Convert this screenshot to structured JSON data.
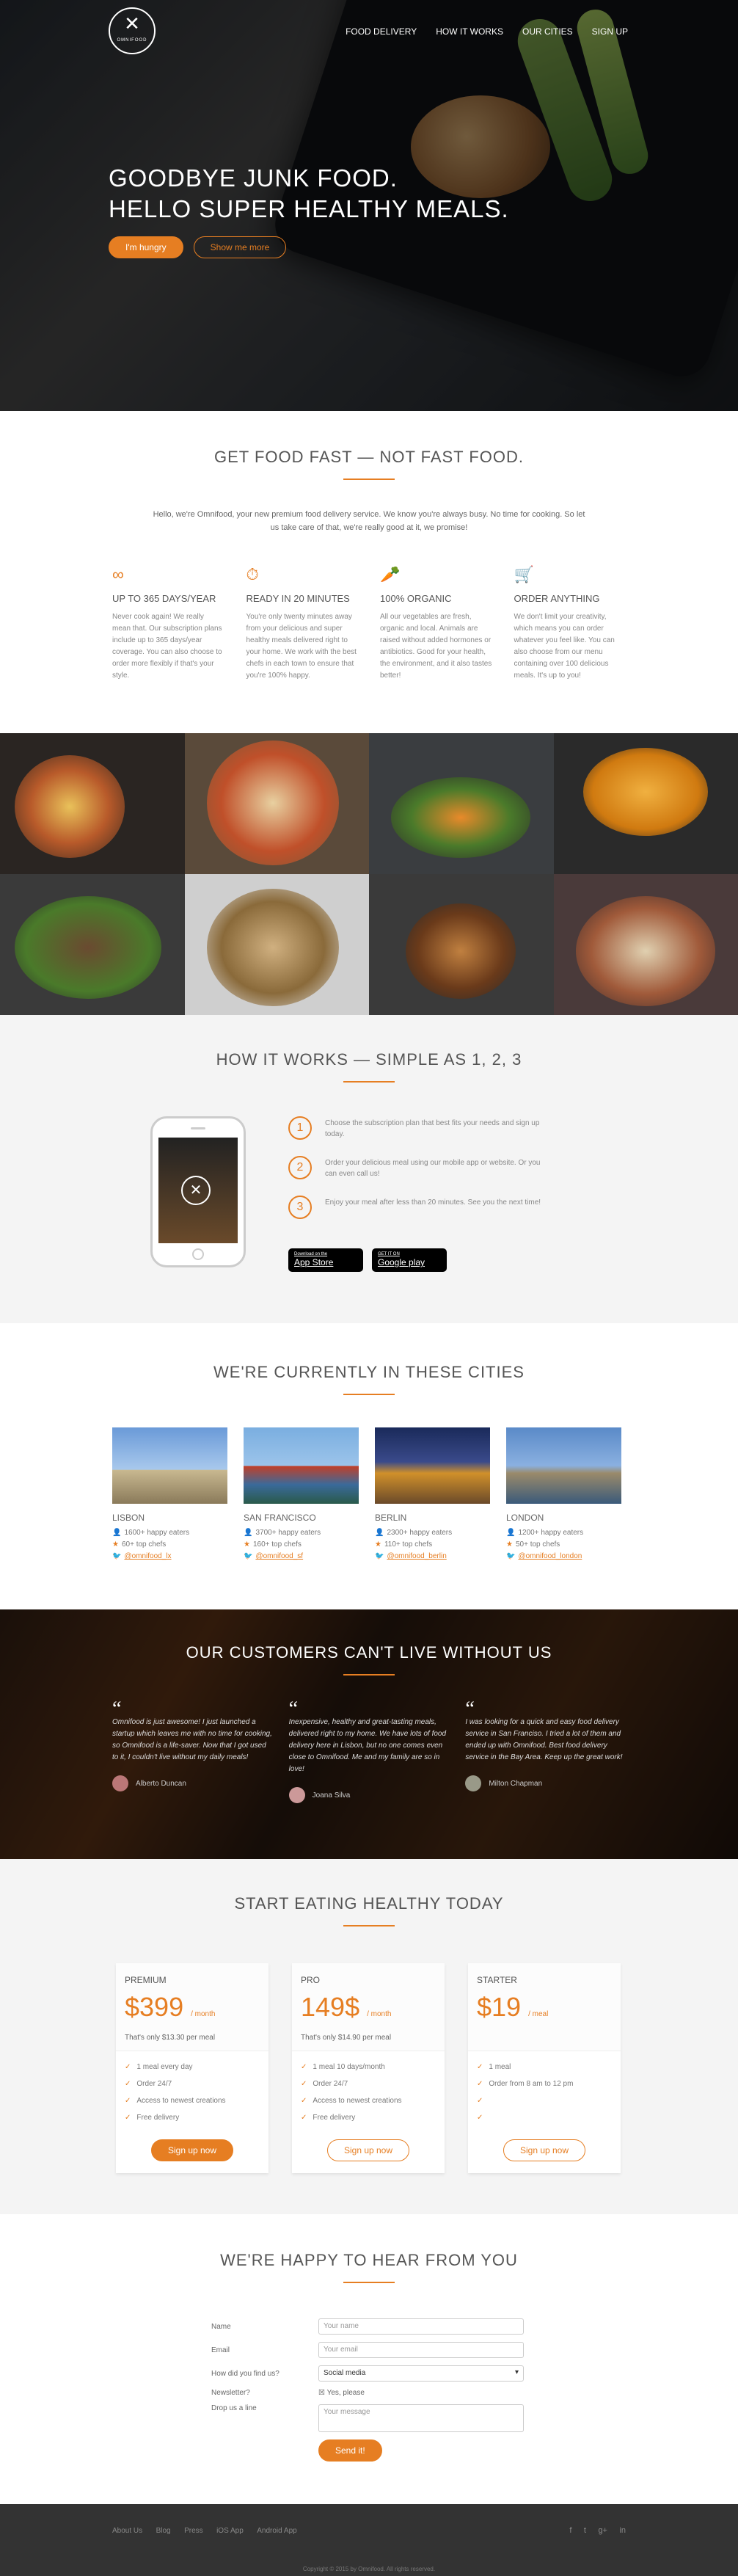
{
  "nav": {
    "logo_text": "OMNIFOOD",
    "items": [
      "FOOD DELIVERY",
      "HOW IT WORKS",
      "OUR CITIES",
      "SIGN UP"
    ]
  },
  "hero": {
    "line1": "GOODBYE JUNK FOOD.",
    "line2": "HELLO SUPER HEALTHY MEALS.",
    "btn_primary": "I'm hungry",
    "btn_secondary": "Show me more"
  },
  "features": {
    "title": "GET FOOD FAST — NOT FAST FOOD.",
    "intro": "Hello, we're Omnifood, your new premium food delivery service. We know you're always busy. No time for cooking. So let us take care of that, we're really good at it, we promise!",
    "items": [
      {
        "icon": "infinity-icon",
        "glyph": "∞",
        "title": "UP TO 365 DAYS/YEAR",
        "text": "Never cook again! We really mean that. Our subscription plans include up to 365 days/year coverage. You can also choose to order more flexibly if that's your style."
      },
      {
        "icon": "stopwatch-icon",
        "glyph": "⏱",
        "title": "READY IN 20 MINUTES",
        "text": "You're only twenty minutes away from your delicious and super healthy meals delivered right to your home. We work with the best chefs in each town to ensure that you're 100% happy."
      },
      {
        "icon": "nutrition-icon",
        "glyph": "🥕",
        "title": "100% ORGANIC",
        "text": "All our vegetables are fresh, organic and local. Animals are raised without added hormones or antibiotics. Good for your health, the environment, and it also tastes better!"
      },
      {
        "icon": "cart-icon",
        "glyph": "🛒",
        "title": "ORDER ANYTHING",
        "text": "We don't limit your creativity, which means you can order whatever you feel like. You can also choose from our menu containing over 100 delicious meals. It's up to you!"
      }
    ]
  },
  "steps": {
    "title": "HOW IT WORKS — SIMPLE AS 1, 2, 3",
    "items": [
      {
        "n": "1",
        "text": "Choose the subscription plan that best fits your needs and sign up today."
      },
      {
        "n": "2",
        "text": "Order your delicious meal using our mobile app or website. Or you can even call us!"
      },
      {
        "n": "3",
        "text": "Enjoy your meal after less than 20 minutes. See you the next time!"
      }
    ],
    "appstore_small": "Download on the",
    "appstore": "App Store",
    "play_small": "GET IT ON",
    "play": "Google play"
  },
  "cities": {
    "title": "WE'RE CURRENTLY IN THESE CITIES",
    "items": [
      {
        "name": "LISBON",
        "eaters": "1600+ happy eaters",
        "chefs": "60+ top chefs",
        "twitter": "@omnifood_lx"
      },
      {
        "name": "SAN FRANCISCO",
        "eaters": "3700+ happy eaters",
        "chefs": "160+ top chefs",
        "twitter": "@omnifood_sf"
      },
      {
        "name": "BERLIN",
        "eaters": "2300+ happy eaters",
        "chefs": "110+ top chefs",
        "twitter": "@omnifood_berlin"
      },
      {
        "name": "LONDON",
        "eaters": "1200+ happy eaters",
        "chefs": "50+ top chefs",
        "twitter": "@omnifood_london"
      }
    ]
  },
  "testimonials": {
    "title": "OUR CUSTOMERS CAN'T LIVE WITHOUT US",
    "items": [
      {
        "text": "Omnifood is just awesome! I just launched a startup which leaves me with no time for cooking, so Omnifood is a life-saver. Now that I got used to it, I couldn't live without my daily meals!",
        "name": "Alberto Duncan"
      },
      {
        "text": "Inexpensive, healthy and great-tasting meals, delivered right to my home. We have lots of food delivery here in Lisbon, but no one comes even close to Omnifood. Me and my family are so in love!",
        "name": "Joana Silva"
      },
      {
        "text": "I was looking for a quick and easy food delivery service in San Franciso. I tried a lot of them and ended up with Omnifood. Best food delivery service in the Bay Area. Keep up the great work!",
        "name": "Milton Chapman"
      }
    ]
  },
  "plans": {
    "title": "START EATING HEALTHY TODAY",
    "items": [
      {
        "name": "PREMIUM",
        "price": "$399",
        "unit": "/ month",
        "per": "That's only $13.30 per meal",
        "features": [
          "1 meal every day",
          "Order 24/7",
          "Access to newest creations",
          "Free delivery"
        ],
        "cta": "Sign up now",
        "style": "full"
      },
      {
        "name": "PRO",
        "price": "149$",
        "unit": "/ month",
        "per": "That's only $14.90 per meal",
        "features": [
          "1 meal 10 days/month",
          "Order 24/7",
          "Access to newest creations",
          "Free delivery"
        ],
        "cta": "Sign up now",
        "style": "ghost"
      },
      {
        "name": "STARTER",
        "price": "$19",
        "unit": "/ meal",
        "per": "",
        "features": [
          "1 meal",
          "Order from 8 am to 12 pm",
          "",
          ""
        ],
        "cta": "Sign up now",
        "style": "ghost"
      }
    ]
  },
  "form": {
    "title": "WE'RE HAPPY TO HEAR FROM YOU",
    "name_label": "Name",
    "name_ph": "Your name",
    "email_label": "Email",
    "email_ph": "Your email",
    "find_label": "How did you find us?",
    "find_value": "Social media",
    "news_label": "Newsletter?",
    "news_value": "Yes, please",
    "msg_label": "Drop us a line",
    "msg_ph": "Your message",
    "submit": "Send it!"
  },
  "footer": {
    "links": [
      "About Us",
      "Blog",
      "Press",
      "iOS App",
      "Android App"
    ],
    "social": [
      "f",
      "t",
      "g+",
      "in"
    ],
    "copyright": "Copyright © 2015 by Omnifood. All rights reserved."
  },
  "colors": {
    "accent": "#e67e22"
  }
}
